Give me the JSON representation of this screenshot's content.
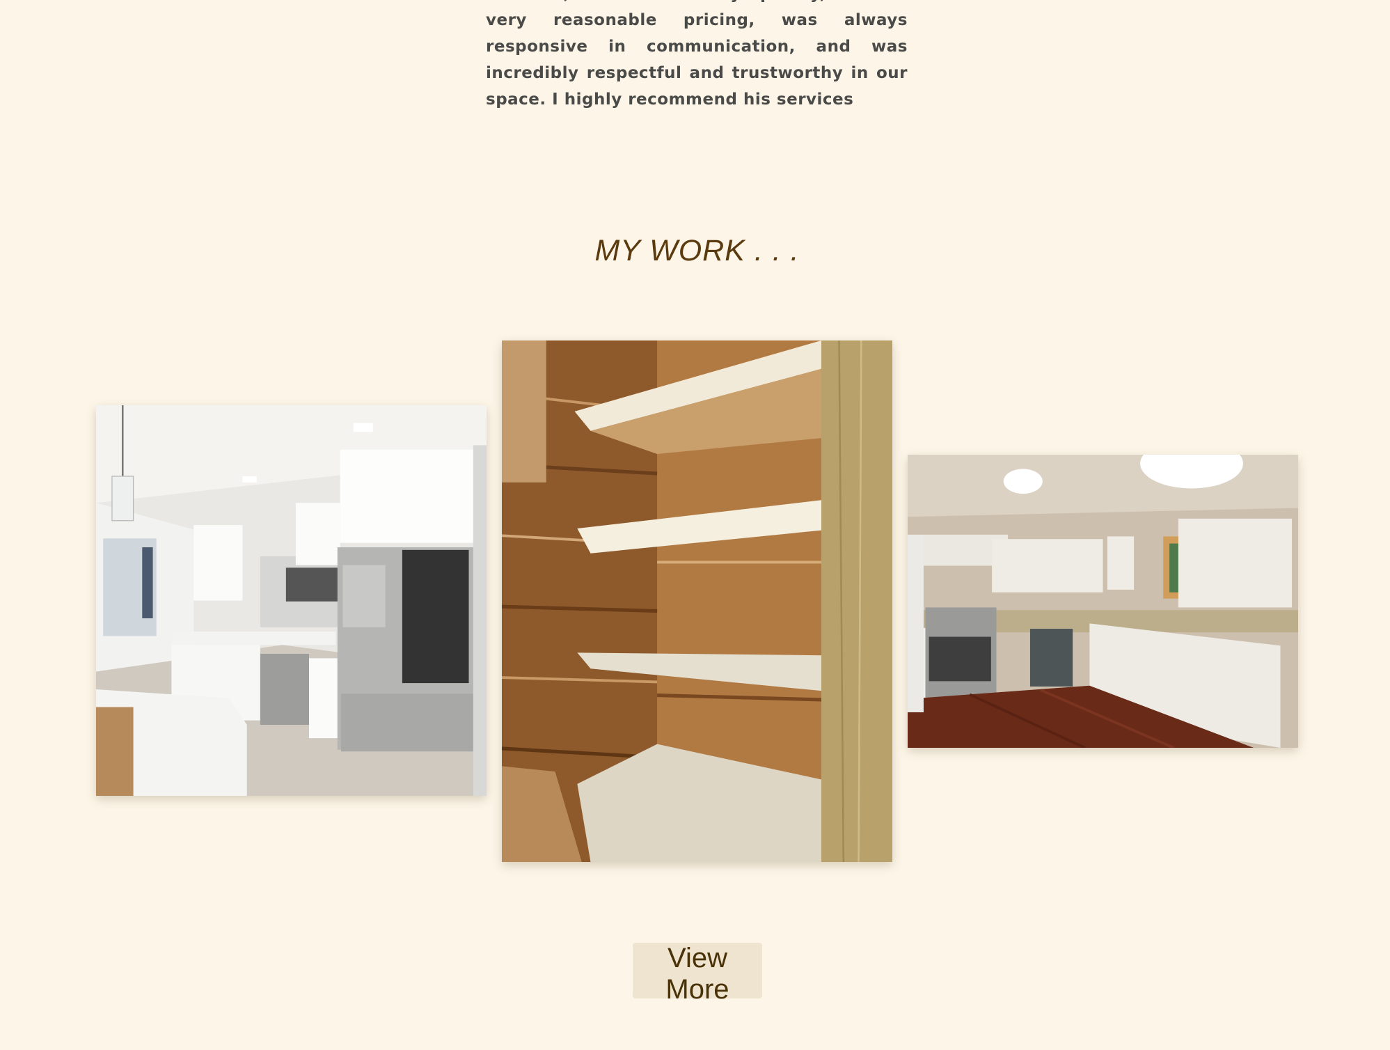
{
  "testimonial": {
    "text": "addition, he worked very quickly, offered very reasonable pricing, was always responsive in communication, and was incredibly respectful and trustworthy in our space. I highly recommend his services"
  },
  "work_section": {
    "title": "MY WORK . . .",
    "photos": [
      {
        "name": "kitchen-photo"
      },
      {
        "name": "cedar-pantry-shelves-photo"
      },
      {
        "name": "l-shaped-kitchen-photo"
      }
    ],
    "view_more_label": "View More"
  },
  "colors": {
    "page_background": "#fdf6e8",
    "title": "#5a3a0e",
    "body_text": "#4a4a48",
    "button_background": "#efe4d0",
    "button_text": "#4a3208"
  }
}
